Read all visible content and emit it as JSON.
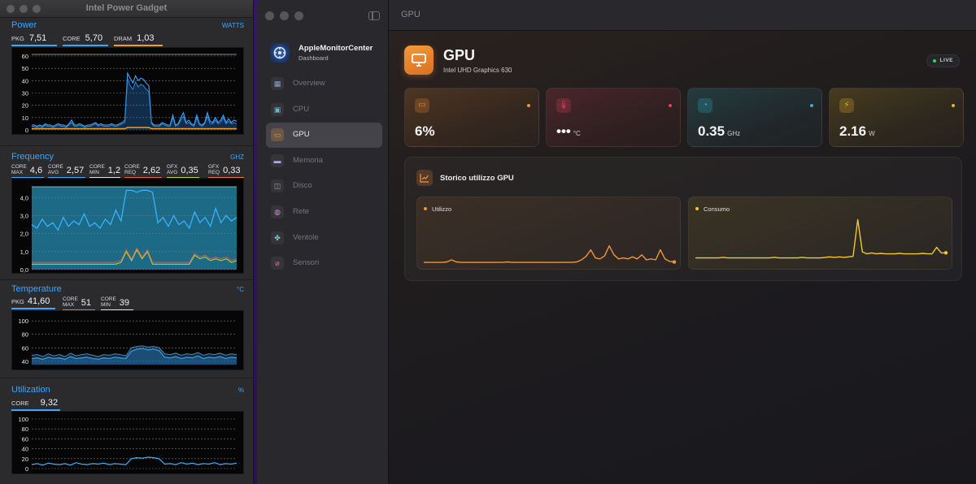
{
  "ipg": {
    "title": "Intel Power Gadget",
    "power": {
      "title": "Power",
      "unit": "WATTS",
      "metrics": [
        {
          "label": "PKG",
          "value": "7,51",
          "color": "#3aa6ff"
        },
        {
          "label": "CORE",
          "value": "5,70",
          "color": "#3aa6ff"
        },
        {
          "label": "DRAM",
          "value": "1,03",
          "color": "#f0a020"
        }
      ],
      "ticks": [
        "60",
        "50",
        "40",
        "30",
        "20",
        "10",
        "0"
      ]
    },
    "frequency": {
      "title": "Frequency",
      "unit": "GHZ",
      "metrics": [
        {
          "top": "CORE",
          "bottom": "MAX",
          "value": "4,6",
          "color": "#3aa6ff"
        },
        {
          "top": "CORE",
          "bottom": "AVG",
          "value": "2,57",
          "color": "#3aa6ff"
        },
        {
          "top": "CORE",
          "bottom": "MIN",
          "value": "1,2",
          "color": "#dddddd"
        },
        {
          "top": "CORE",
          "bottom": "REQ",
          "value": "2,62",
          "color": "#e05a5a"
        },
        {
          "top": "GFX",
          "bottom": "AVG",
          "value": "0,35",
          "color": "#b6d13a"
        },
        {
          "top": "GFX",
          "bottom": "REQ",
          "value": "0,33",
          "color": "#e07a40"
        }
      ],
      "ticks": [
        "4,0",
        "3,0",
        "2,0",
        "1,0",
        "0,0"
      ]
    },
    "temperature": {
      "title": "Temperature",
      "unit": "°C",
      "metrics": [
        {
          "label": "PKG",
          "value": "41,60",
          "color": "#3aa6ff"
        },
        {
          "top": "CORE",
          "bottom": "MAX",
          "value": "51",
          "color": "#3aa6ff"
        },
        {
          "top": "CORE",
          "bottom": "MIN",
          "value": "39",
          "color": "#dddddd"
        }
      ],
      "ticks": [
        "100",
        "80",
        "60",
        "40"
      ]
    },
    "utilization": {
      "title": "Utilization",
      "unit": "%",
      "metrics": [
        {
          "label": "CORE",
          "value": "9,32",
          "color": "#3aa6ff"
        }
      ],
      "ticks": [
        "100",
        "80",
        "60",
        "40",
        "20",
        "0"
      ]
    }
  },
  "amc": {
    "app_name": "AppleMonitorCenter",
    "app_sub": "Dashboard",
    "nav": [
      {
        "label": "Overview",
        "icon": "grid-icon",
        "color": "#8fa0c8"
      },
      {
        "label": "CPU",
        "icon": "cpu-icon",
        "color": "#6fb2c8"
      },
      {
        "label": "GPU",
        "icon": "monitor-icon",
        "color": "#f0953a",
        "active": true
      },
      {
        "label": "Memoria",
        "icon": "memory-icon",
        "color": "#b2a8e8"
      },
      {
        "label": "Disco",
        "icon": "disk-icon",
        "color": "#9a9aa2"
      },
      {
        "label": "Rete",
        "icon": "globe-icon",
        "color": "#c58adf"
      },
      {
        "label": "Ventole",
        "icon": "fan-icon",
        "color": "#80c8d8"
      },
      {
        "label": "Sensori",
        "icon": "thermometer-icon",
        "color": "#e07a7a"
      }
    ],
    "page_title": "GPU",
    "gpu": {
      "name": "GPU",
      "model": "Intel UHD Graphics 630",
      "live_label": "LIVE"
    },
    "cards": [
      {
        "icon": "monitor-icon",
        "value": "6%",
        "unit": "",
        "accent": "#e8892f",
        "dot": "#f0953a"
      },
      {
        "icon": "thermometer-icon",
        "value": "•••",
        "unit": "°C",
        "accent": "#e0405a",
        "dot": "#e0405a"
      },
      {
        "icon": "gauge-icon",
        "value": "0.35",
        "unit": "GHz",
        "accent": "#2fb3c9",
        "dot": "#2fb3c9"
      },
      {
        "icon": "bolt-icon",
        "value": "2.16",
        "unit": "W",
        "accent": "#e2b52a",
        "dot": "#e2b52a"
      }
    ],
    "history": {
      "title": "Storico utilizzo GPU",
      "charts": [
        {
          "label": "Utilizzo",
          "color": "#f0953a"
        },
        {
          "label": "Consumo",
          "color": "#f2c92a"
        }
      ]
    }
  },
  "chart_data": [
    {
      "type": "line",
      "title": "Power",
      "ylabel": "WATTS",
      "ylim": [
        0,
        60
      ],
      "series": [
        {
          "name": "PKG",
          "values": [
            4,
            4,
            3,
            4,
            3,
            5,
            4,
            4,
            3,
            4,
            5,
            4,
            4,
            3,
            5,
            8,
            4,
            4,
            5,
            4,
            3,
            4,
            4,
            5,
            6,
            4,
            5,
            4,
            4,
            4,
            5,
            4,
            4,
            5,
            6,
            8,
            46,
            42,
            38,
            44,
            40,
            42,
            41,
            38,
            36,
            6,
            4,
            4,
            4,
            6,
            5,
            4,
            4,
            12,
            4,
            5,
            10,
            14,
            6,
            8,
            5,
            4,
            12,
            5,
            4,
            6,
            14,
            7,
            6,
            10,
            6,
            8,
            12,
            6,
            9,
            6,
            8,
            7
          ]
        },
        {
          "name": "CORE",
          "values": [
            3,
            3,
            2,
            3,
            2,
            4,
            3,
            3,
            2,
            3,
            4,
            3,
            3,
            2,
            4,
            6,
            3,
            3,
            4,
            3,
            2,
            3,
            3,
            4,
            5,
            3,
            4,
            3,
            3,
            3,
            4,
            3,
            3,
            4,
            5,
            6,
            42,
            36,
            33,
            39,
            35,
            37,
            36,
            33,
            31,
            5,
            3,
            3,
            3,
            5,
            4,
            3,
            3,
            10,
            3,
            4,
            8,
            11,
            5,
            6,
            4,
            3,
            10,
            4,
            3,
            5,
            11,
            5,
            5,
            8,
            5,
            6,
            10,
            5,
            7,
            5,
            6,
            5
          ]
        },
        {
          "name": "DRAM",
          "values": [
            1,
            1,
            1,
            1,
            1,
            1,
            1,
            1,
            1,
            1,
            1,
            1,
            1,
            1,
            1,
            1,
            1,
            1,
            1,
            1,
            1,
            1,
            1,
            1,
            1,
            1,
            1,
            1,
            1,
            1,
            1,
            1,
            1,
            1,
            1,
            1,
            2,
            2,
            2,
            2,
            2,
            2,
            2,
            2,
            2,
            1,
            1,
            1,
            1,
            1,
            1,
            1,
            1,
            1,
            1,
            1,
            1,
            1,
            1,
            1,
            1,
            1,
            1,
            1,
            1,
            1,
            1,
            1,
            1,
            1,
            1,
            1,
            1,
            1,
            1,
            1,
            1,
            1
          ]
        }
      ]
    },
    {
      "type": "line",
      "title": "Frequency",
      "ylabel": "GHZ",
      "ylim": [
        0,
        4.6
      ],
      "series": [
        {
          "name": "CORE MAX",
          "values": [
            4.6,
            4.6,
            4.6,
            4.6,
            4.6,
            4.6,
            4.6,
            4.6,
            4.6,
            4.6,
            4.6,
            4.6,
            4.6,
            4.6,
            4.6,
            4.6,
            4.6,
            4.6,
            4.6,
            4.6,
            4.6,
            4.6,
            4.6,
            4.6,
            4.6,
            4.6,
            4.6,
            4.6,
            4.6,
            4.6,
            4.6,
            4.6,
            4.6,
            4.6,
            4.6,
            4.6,
            4.6,
            4.6,
            4.6,
            4.6
          ]
        },
        {
          "name": "CORE AVG",
          "values": [
            2.5,
            2.3,
            2.8,
            2.4,
            2.6,
            2.2,
            2.9,
            2.4,
            2.7,
            2.5,
            3.1,
            2.4,
            2.6,
            2.3,
            2.8,
            2.5,
            3.3,
            2.7,
            4.4,
            4.4,
            4.3,
            4.4,
            4.4,
            4.3,
            2.6,
            2.9,
            2.4,
            3.0,
            2.5,
            2.7,
            2.3,
            3.2,
            2.6,
            2.9,
            2.4,
            3.4,
            2.6,
            3.0,
            2.7,
            2.9
          ]
        },
        {
          "name": "GFX AVG",
          "values": [
            0.3,
            0.3,
            0.3,
            0.3,
            0.3,
            0.3,
            0.3,
            0.3,
            0.3,
            0.3,
            0.3,
            0.3,
            0.3,
            0.3,
            0.3,
            0.3,
            0.3,
            0.4,
            1.0,
            0.5,
            1.1,
            0.6,
            1.0,
            0.3,
            0.3,
            0.3,
            0.3,
            0.3,
            0.3,
            0.3,
            0.3,
            0.8,
            0.6,
            0.7,
            0.5,
            0.6,
            0.5,
            0.6,
            0.4,
            0.5
          ]
        },
        {
          "name": "GFX REQ",
          "values": [
            0.4,
            0.4,
            0.4,
            0.4,
            0.4,
            0.4,
            0.4,
            0.4,
            0.4,
            0.4,
            0.4,
            0.4,
            0.4,
            0.4,
            0.4,
            0.4,
            0.4,
            0.5,
            1.1,
            0.6,
            1.2,
            0.7,
            1.1,
            0.4,
            0.4,
            0.4,
            0.4,
            0.4,
            0.4,
            0.4,
            0.4,
            0.9,
            0.7,
            0.8,
            0.6,
            0.7,
            0.6,
            0.7,
            0.5,
            0.6
          ]
        }
      ]
    },
    {
      "type": "area",
      "title": "Temperature",
      "ylabel": "°C",
      "ylim": [
        35,
        105
      ],
      "series": [
        {
          "name": "PKG",
          "values": [
            44,
            45,
            43,
            46,
            44,
            45,
            43,
            47,
            44,
            45,
            46,
            44,
            43,
            45,
            44,
            46,
            45,
            44,
            55,
            58,
            59,
            57,
            58,
            56,
            46,
            45,
            47,
            44,
            46,
            45,
            48,
            44,
            46,
            45,
            47,
            44,
            46,
            45
          ]
        },
        {
          "name": "CORE MAX",
          "values": [
            49,
            50,
            47,
            51,
            48,
            50,
            47,
            52,
            48,
            50,
            51,
            49,
            47,
            50,
            49,
            51,
            50,
            48,
            60,
            62,
            63,
            61,
            62,
            60,
            51,
            50,
            52,
            49,
            51,
            50,
            53,
            49,
            51,
            50,
            52,
            49,
            51,
            50
          ]
        }
      ]
    },
    {
      "type": "line",
      "title": "Utilization",
      "ylabel": "%",
      "ylim": [
        0,
        100
      ],
      "series": [
        {
          "name": "CORE",
          "values": [
            8,
            10,
            7,
            11,
            9,
            8,
            10,
            7,
            12,
            9,
            8,
            10,
            9,
            11,
            8,
            10,
            9,
            8,
            20,
            22,
            21,
            23,
            22,
            20,
            9,
            10,
            8,
            12,
            9,
            11,
            8,
            10,
            9,
            12,
            8,
            10,
            9,
            11
          ]
        }
      ]
    },
    {
      "type": "line",
      "title": "Utilizzo",
      "ylim": [
        0,
        100
      ],
      "series": [
        {
          "name": "Utilizzo",
          "values": [
            3,
            3,
            3,
            3,
            3,
            4,
            8,
            4,
            3,
            3,
            3,
            3,
            3,
            3,
            3,
            3,
            3,
            3,
            4,
            3,
            3,
            3,
            3,
            3,
            3,
            3,
            3,
            3,
            3,
            3,
            3,
            3,
            3,
            4,
            8,
            15,
            28,
            12,
            10,
            16,
            36,
            18,
            10,
            12,
            10,
            14,
            10,
            18,
            8,
            10,
            8,
            28,
            10,
            5,
            4
          ]
        }
      ]
    },
    {
      "type": "line",
      "title": "Consumo",
      "ylim": [
        0,
        10
      ],
      "series": [
        {
          "name": "Consumo",
          "values": [
            1.2,
            1.2,
            1.2,
            1.2,
            1.2,
            1.2,
            1.3,
            1.2,
            1.2,
            1.2,
            1.2,
            1.2,
            1.2,
            1.2,
            1.2,
            1.2,
            1.2,
            1.3,
            1.2,
            1.2,
            1.2,
            1.2,
            1.2,
            1.3,
            1.2,
            1.2,
            1.2,
            1.2,
            1.3,
            1.4,
            1.3,
            1.4,
            1.3,
            1.4,
            1.5,
            8.8,
            2.4,
            2.0,
            2.2,
            2.0,
            2.1,
            2.0,
            2.0,
            2.0,
            2.1,
            2.0,
            2.0,
            2.0,
            2.0,
            2.1,
            2.0,
            2.0,
            3.3,
            2.2,
            2.2
          ]
        }
      ]
    }
  ]
}
